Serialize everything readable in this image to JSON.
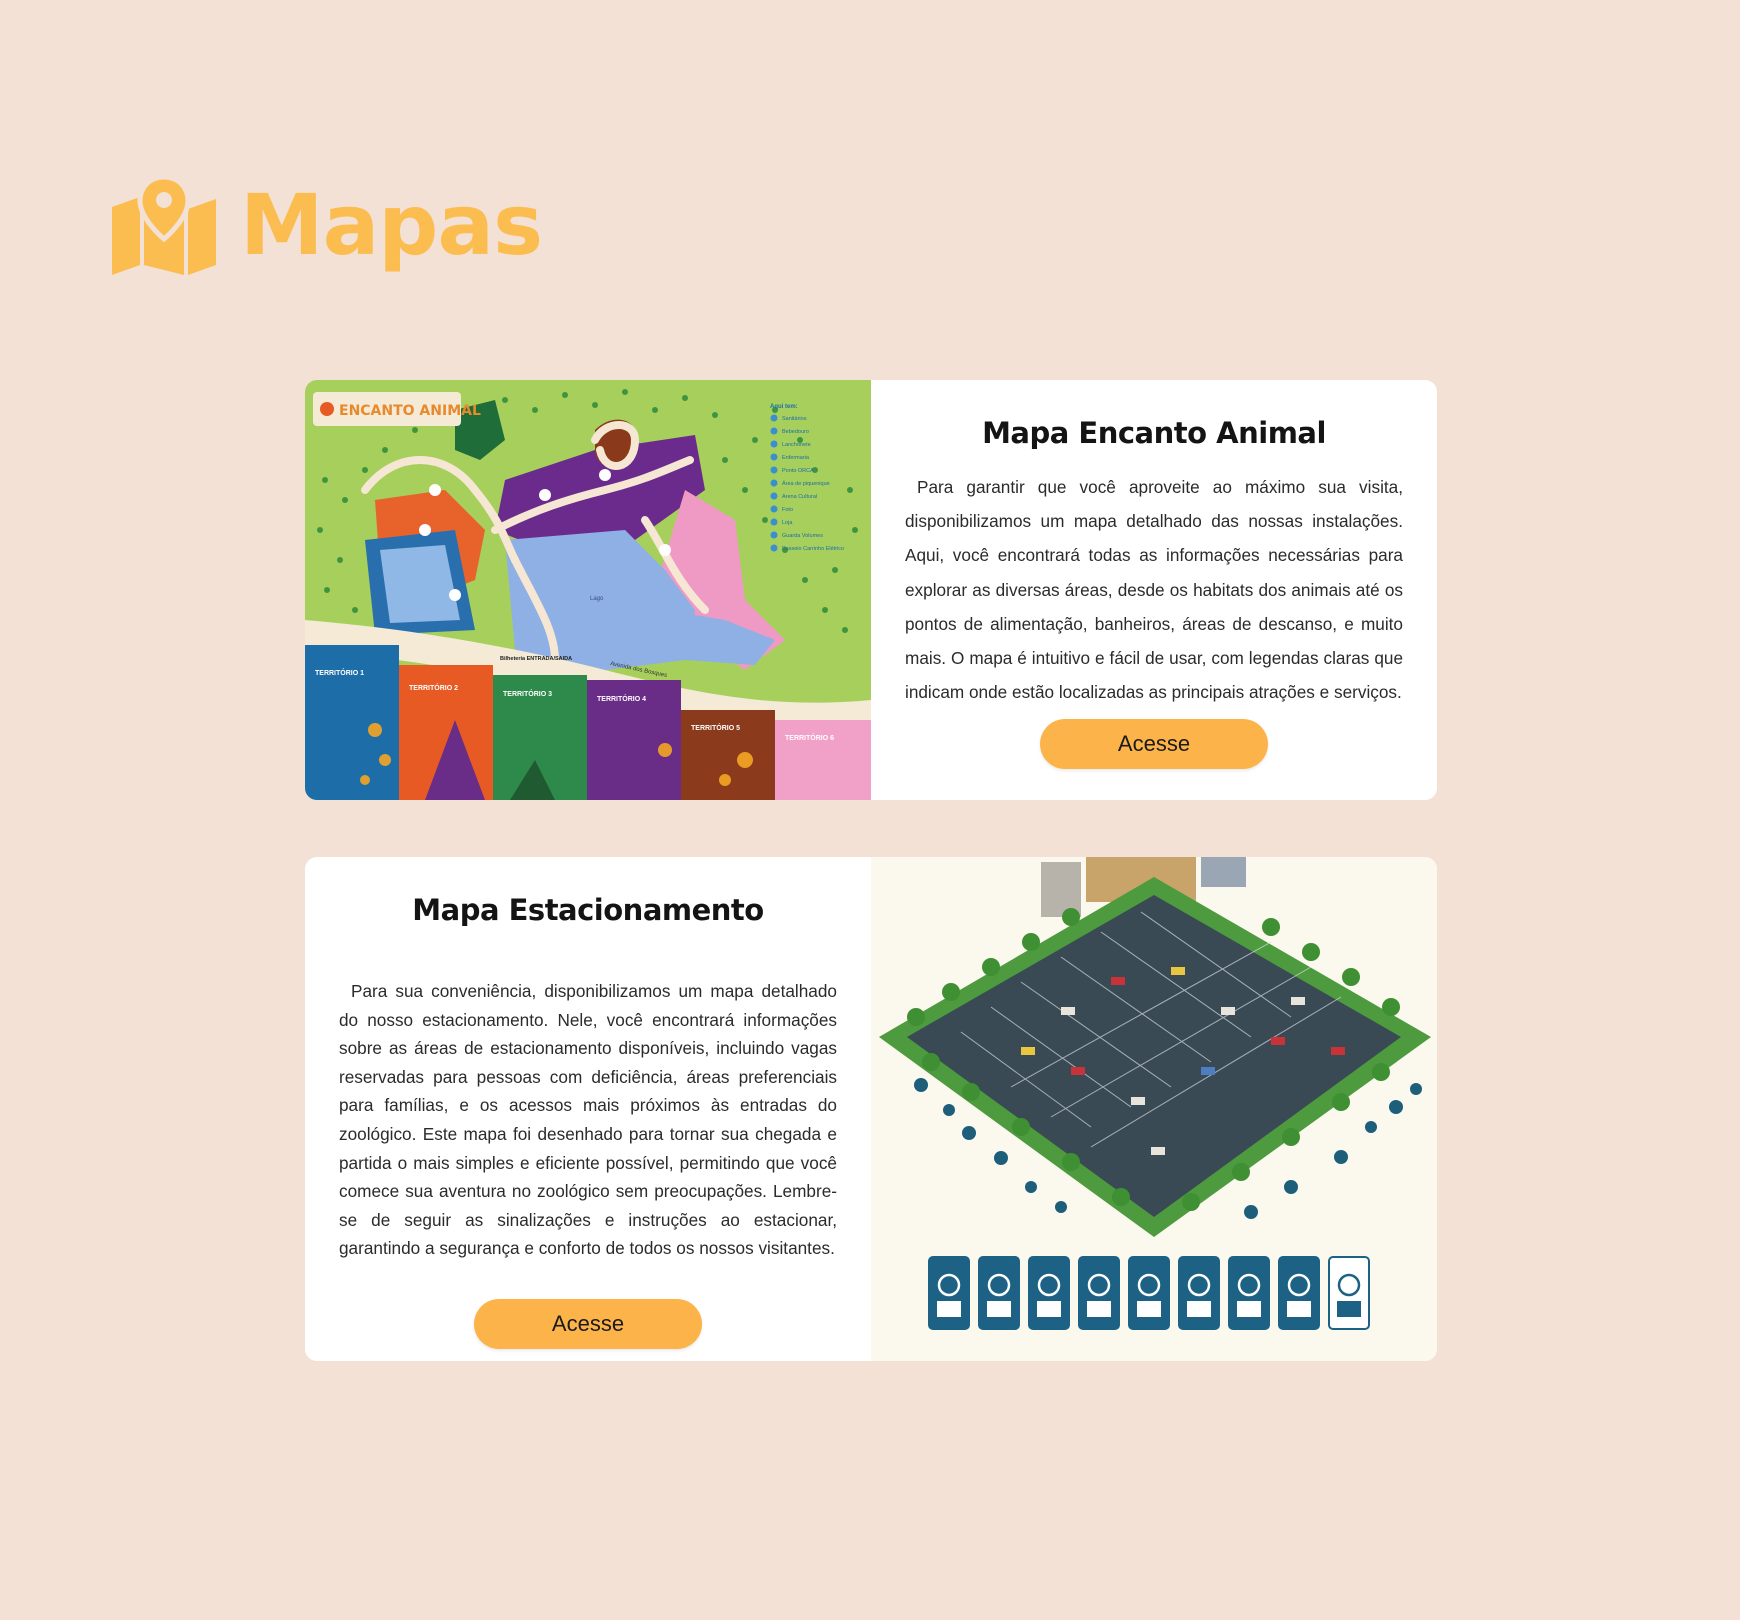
{
  "header": {
    "title": "Mapas",
    "icon": "map-pin-icon",
    "accent_color": "#fcbd50"
  },
  "page": {
    "background": "#f2e1d4"
  },
  "cards": [
    {
      "image": {
        "description_icon": "zoo-map-image",
        "brand": "ENCANTO ANIMAL",
        "lake_label": "Lago",
        "entrance_label": "Bilheteria ENTRADA/SAIDA",
        "road_label": "Avenida dos Bosques",
        "legend_title": "Aqui tem:",
        "legend_items": [
          "Sanitários",
          "Bebedouro",
          "Lanchonete",
          "Enfermaria",
          "Ponto ORCA",
          "Área de piquenique",
          "Arena Cultural",
          "Foto",
          "Loja",
          "Guarda Volumes",
          "Passeio Carrinho Elétrico"
        ],
        "territories": [
          {
            "label": "TERRITÓRIO 1",
            "color": "#1d6ea8"
          },
          {
            "label": "TERRITÓRIO 2",
            "color": "#e85a24"
          },
          {
            "label": "TERRITÓRIO 3",
            "color": "#2e8a4a"
          },
          {
            "label": "TERRITÓRIO 4",
            "color": "#6a2d87"
          },
          {
            "label": "TERRITÓRIO 5",
            "color": "#8b3a1c"
          },
          {
            "label": "TERRITÓRIO 6",
            "color": "#f1a0c8"
          }
        ]
      },
      "title": "Mapa Encanto Animal",
      "text": "Para garantir que você aproveite ao máximo sua visita, disponibilizamos um mapa detalhado das nossas instalações. Aqui, você encontrará todas as informações necessárias para explorar as diversas áreas, desde os habitats dos animais até os pontos de alimentação, banheiros, áreas de descanso, e muito mais. O mapa é intuitivo e fácil de usar, com legendas claras que indicam onde estão localizadas as principais atrações e serviços.",
      "button_label": "Acesse"
    },
    {
      "image": {
        "description_icon": "parking-map-image",
        "sign_icons": [
          "woman-icon",
          "person-car-icon",
          "car-icon",
          "car-icon",
          "accessible-icon",
          "wheelchair-icon",
          "wheelchair-icon",
          "bicycle-icon",
          "family-icon"
        ]
      },
      "title": "Mapa Estacionamento",
      "text": "Para sua conveniência, disponibilizamos um mapa detalhado do nosso estacionamento. Nele, você encontrará informações sobre as áreas de estacionamento disponíveis, incluindo vagas reservadas para pessoas com deficiência, áreas preferenciais para famílias, e os acessos mais próximos às entradas do zoológico. Este mapa foi desenhado para tornar sua chegada e partida o mais simples e eficiente possível, permitindo que você comece sua aventura no zoológico sem preocupações. Lembre-se de seguir as sinalizações e instruções ao estacionar, garantindo a segurança e conforto de todos os nossos visitantes.",
      "button_label": "Acesse"
    }
  ]
}
